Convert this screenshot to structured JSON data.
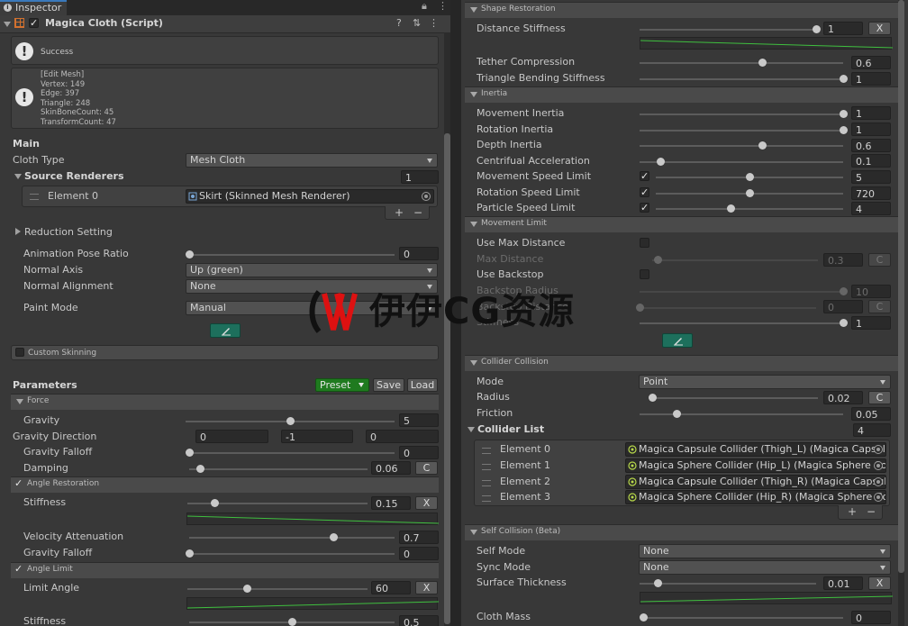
{
  "inspector": {
    "tab_label": "Inspector",
    "component_title": "Magica Cloth (Script)"
  },
  "help": {
    "status": "Success",
    "edit_mesh": [
      "[Edit Mesh]",
      "Vertex: 149",
      "Edge: 397",
      "Triangle: 248",
      "SkinBoneCount: 45",
      "TransformCount: 47"
    ]
  },
  "main": {
    "heading": "Main",
    "cloth_type_label": "Cloth Type",
    "cloth_type_value": "Mesh Cloth",
    "source_renderers_label": "Source Renderers",
    "source_renderers_count": "1",
    "element0_label": "Element 0",
    "element0_value": "Skirt (Skinned Mesh Renderer)",
    "add": "+",
    "remove": "−",
    "reduction_label": "Reduction Setting",
    "animation_pose_ratio_label": "Animation Pose Ratio",
    "animation_pose_ratio_value": "0",
    "animation_pose_ratio_level": 0,
    "normal_axis_label": "Normal Axis",
    "normal_axis_value": "Up (green)",
    "normal_alignment_label": "Normal Alignment",
    "normal_alignment_value": "None",
    "paint_mode_label": "Paint Mode",
    "paint_mode_value": "Manual",
    "custom_skinning_label": "Custom Skinning"
  },
  "parameters": {
    "heading": "Parameters",
    "preset_label": "Preset",
    "save_label": "Save",
    "load_label": "Load",
    "force_header": "Force",
    "gravity_label": "Gravity",
    "gravity_value": "5",
    "gravity_level": 0.5,
    "gravity_direction_label": "Gravity Direction",
    "gravity_direction": [
      "0",
      "-1",
      "0"
    ],
    "gravity_falloff_label": "Gravity Falloff",
    "gravity_falloff_value": "0",
    "gravity_falloff_level": 0,
    "damping_label": "Damping",
    "damping_value": "0.06",
    "damping_level": 0.06,
    "c_label": "C",
    "x_label": "X",
    "angle_restoration_header": "Angle Restoration",
    "stiffness_label": "Stiffness",
    "stiffness_value": "0.15",
    "stiffness_level": 0.15,
    "velocity_attenuation_label": "Velocity Attenuation",
    "velocity_attenuation_value": "0.7",
    "velocity_attenuation_level": 0.7,
    "gravity_falloff2_label": "Gravity Falloff",
    "gravity_falloff2_value": "0",
    "gravity_falloff2_level": 0,
    "angle_limit_header": "Angle Limit",
    "limit_angle_label": "Limit Angle",
    "limit_angle_value": "60",
    "limit_angle_level": 0.33,
    "stiffness2_label": "Stiffness",
    "stiffness2_value": "0.5",
    "stiffness2_level": 0.5
  },
  "right": {
    "shape_restoration_header": "Shape Restoration",
    "distance_stiffness_label": "Distance Stiffness",
    "distance_stiffness_value": "1",
    "distance_stiffness_level": 1,
    "tether_compression_label": "Tether Compression",
    "tether_compression_value": "0.6",
    "tether_compression_level": 0.6,
    "triangle_bending_label": "Triangle Bending Stiffness",
    "triangle_bending_value": "1",
    "triangle_bending_level": 1,
    "inertia_header": "Inertia",
    "movement_inertia_label": "Movement Inertia",
    "movement_inertia_value": "1",
    "movement_inertia_level": 1,
    "rotation_inertia_label": "Rotation Inertia",
    "rotation_inertia_value": "1",
    "rotation_inertia_level": 1,
    "depth_inertia_label": "Depth Inertia",
    "depth_inertia_value": "0.6",
    "depth_inertia_level": 0.6,
    "centrifugal_label": "Centrifual Acceleration",
    "centrifugal_value": "0.1",
    "centrifugal_level": 0.1,
    "movement_speed_limit_label": "Movement Speed Limit",
    "movement_speed_limit_value": "5",
    "movement_speed_limit_level": 0.5,
    "rotation_speed_limit_label": "Rotation Speed Limit",
    "rotation_speed_limit_value": "720",
    "rotation_speed_limit_level": 0.5,
    "particle_speed_limit_label": "Particle Speed Limit",
    "particle_speed_limit_value": "4",
    "particle_speed_limit_level": 0.4,
    "movement_limit_header": "Movement Limit",
    "use_max_distance_label": "Use Max Distance",
    "max_distance_label": "Max Distance",
    "max_distance_value": "0.3",
    "max_distance_level": 0.03,
    "use_backstop_label": "Use Backstop",
    "backstop_radius_label": "Backstop Radius",
    "backstop_radius_value": "10",
    "backstop_radius_level": 1,
    "backstop_distance_label": "Backstop Distance",
    "backstop_distance_value": "0",
    "backstop_distance_level": 0,
    "stiffness_label": "Stiffness",
    "stiffness_value": "1",
    "stiffness_level": 1,
    "collider_collision_header": "Collider Collision",
    "mode_label": "Mode",
    "mode_value": "Point",
    "radius_label": "Radius",
    "radius_value": "0.02",
    "radius_level": 0.02,
    "friction_label": "Friction",
    "friction_value": "0.05",
    "friction_level": 0.18,
    "collider_list_label": "Collider List",
    "collider_list_count": "4",
    "colliders": [
      {
        "label": "Element 0",
        "value": "Magica Capsule Collider (Thigh_L) (Magica Capsule"
      },
      {
        "label": "Element 1",
        "value": "Magica Sphere Collider (Hip_L) (Magica Sphere Col"
      },
      {
        "label": "Element 2",
        "value": "Magica Capsule Collider (Thigh_R) (Magica Capsule"
      },
      {
        "label": "Element 3",
        "value": "Magica Sphere Collider (Hip_R) (Magica Sphere Col"
      }
    ],
    "self_collision_header": "Self Collision (Beta)",
    "self_mode_label": "Self Mode",
    "self_mode_value": "None",
    "sync_mode_label": "Sync Mode",
    "sync_mode_value": "None",
    "surface_thickness_label": "Surface Thickness",
    "surface_thickness_value": "0.01",
    "surface_thickness_level": 0.1,
    "cloth_mass_label": "Cloth Mass",
    "cloth_mass_value": "0",
    "cloth_mass_level": 0
  },
  "watermark": {
    "text": "伊伊CG资源"
  },
  "colors": {
    "panel": "#383838",
    "header_bar": "#4a4a4a",
    "preset_green": "#1f7a1f",
    "paint_teal": "#1d6f5c",
    "curve_green": "#3fbf3f"
  }
}
